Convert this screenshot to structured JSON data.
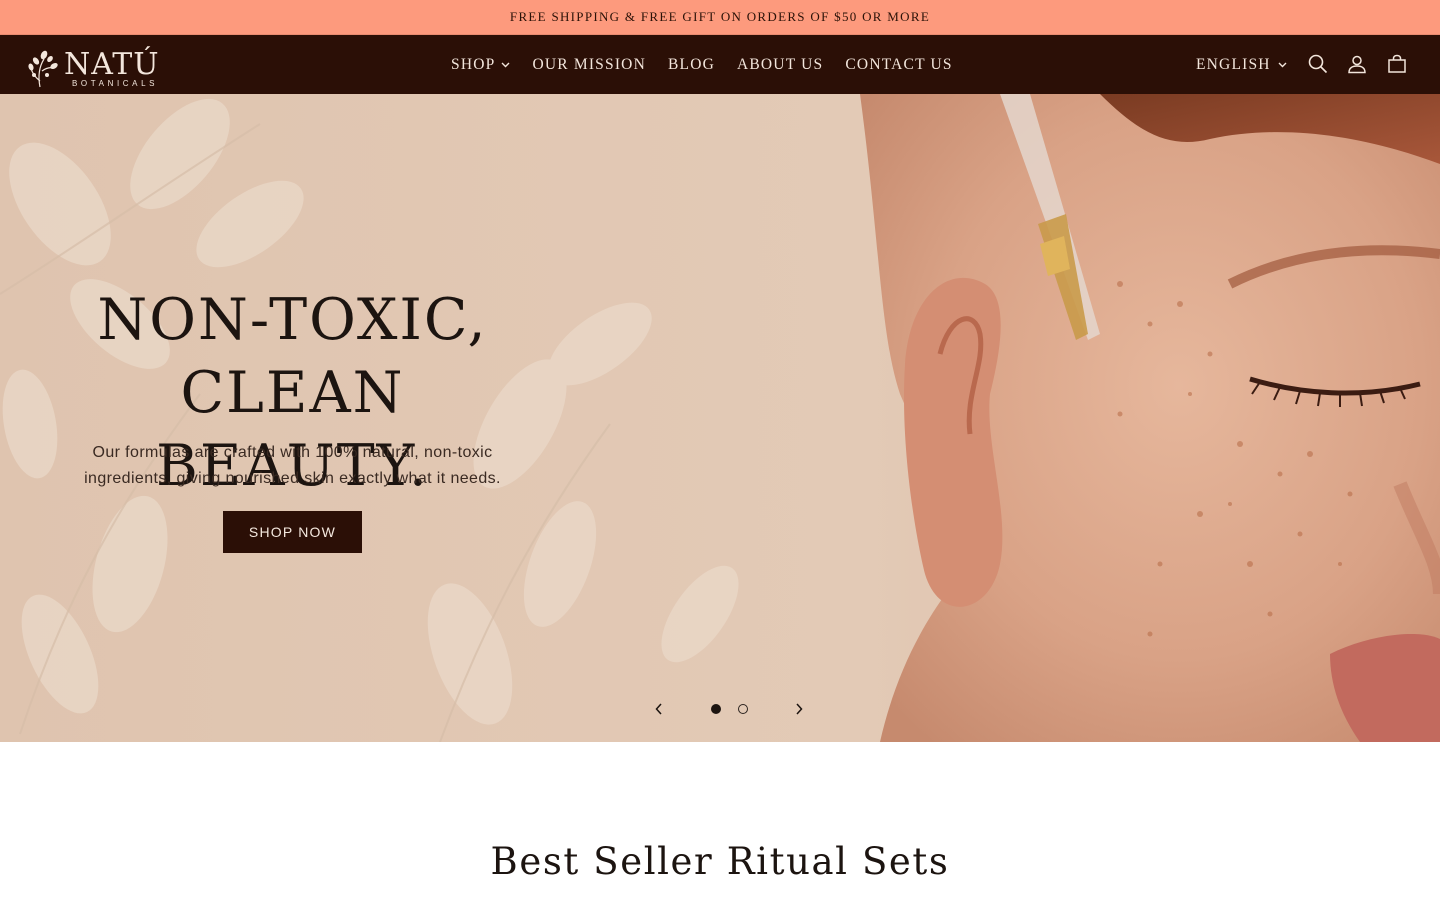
{
  "announcement": {
    "text": "FREE SHIPPING & FREE GIFT ON ORDERS OF $50 OR MORE"
  },
  "header": {
    "logo_text": "NATÚ",
    "logo_subtext": "BOTANICALS",
    "nav": [
      {
        "label": "SHOP",
        "has_dropdown": true
      },
      {
        "label": "OUR MISSION"
      },
      {
        "label": "BLOG"
      },
      {
        "label": "ABOUT US"
      },
      {
        "label": "CONTACT US"
      }
    ],
    "language": "ENGLISH",
    "icons": [
      "search-icon",
      "account-icon",
      "cart-icon"
    ]
  },
  "hero": {
    "title_line1": "NON-TOXIC,",
    "title_line2": "CLEAN BEAUTY.",
    "subtitle": "Our formulas are crafted with 100% natural, non-toxic ingredients, giving nourished skin exactly what it needs.",
    "button": "SHOP NOW",
    "slides_total": 2,
    "slide_active": 1
  },
  "section": {
    "title": "Best Seller Ritual Sets"
  },
  "colors": {
    "announcement_bg": "#fd9a7d",
    "header_bg": "#2b0f06",
    "hero_bg": "#e1c8b4",
    "text_dark": "#1c1410"
  }
}
